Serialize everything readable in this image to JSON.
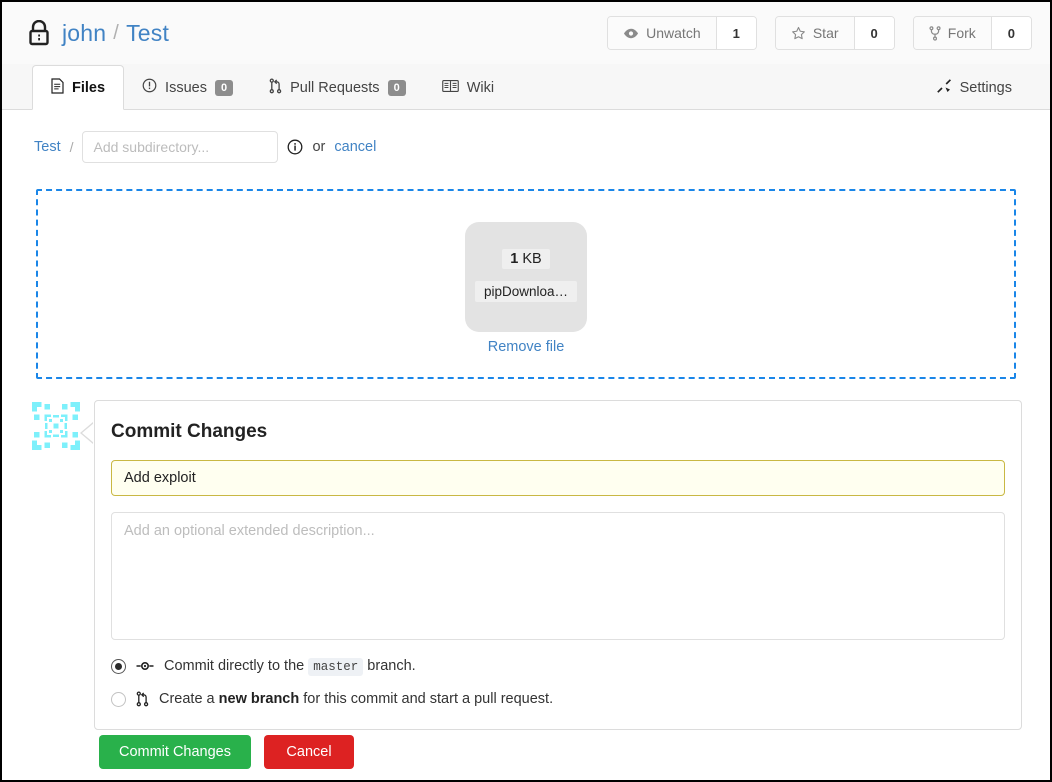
{
  "header": {
    "lock_icon": "lock-icon",
    "owner": "john",
    "separator": "/",
    "repo": "Test",
    "actions": [
      {
        "icon": "eye-icon",
        "label": "Unwatch",
        "count": "1"
      },
      {
        "icon": "star-icon",
        "label": "Star",
        "count": "0"
      },
      {
        "icon": "fork-icon",
        "label": "Fork",
        "count": "0"
      }
    ]
  },
  "tabs": {
    "items": [
      {
        "icon": "file-icon",
        "label": "Files",
        "count": null,
        "active": true
      },
      {
        "icon": "issue-opened-icon",
        "label": "Issues",
        "count": "0",
        "active": false
      },
      {
        "icon": "git-pull-request-icon",
        "label": "Pull Requests",
        "count": "0",
        "active": false
      },
      {
        "icon": "book-icon",
        "label": "Wiki",
        "count": null,
        "active": false
      }
    ],
    "settings": {
      "icon": "tools-icon",
      "label": "Settings"
    }
  },
  "path_row": {
    "crumb": "Test",
    "crumb_separator": "/",
    "subdirectory_placeholder": "Add subdirectory...",
    "subdirectory_value": "",
    "info_icon": "info-icon",
    "or_text": "or",
    "cancel_label": "cancel"
  },
  "dropzone": {
    "border_color": "#1a86e8",
    "file": {
      "size_value": "1",
      "size_unit": "KB",
      "name": "pipDownloa…",
      "highlight_color": "#e11919",
      "remove_label": "Remove file"
    }
  },
  "commit": {
    "avatar_icon": "identicon-avatar",
    "avatar_color": "#7df0fb",
    "title": "Commit Changes",
    "message_value": "Add exploit",
    "message_placeholder": "",
    "description_value": "",
    "description_placeholder": "Add an optional extended description...",
    "options": [
      {
        "icon": "git-commit-icon",
        "selected": true,
        "text_before": "Commit directly to the",
        "code": "master",
        "text_after": "branch."
      },
      {
        "icon": "git-pull-request-icon",
        "selected": false,
        "text_before": "Create a",
        "bold": "new branch",
        "text_after": "for this commit and start a pull request."
      }
    ],
    "buttons": {
      "submit_label": "Commit Changes",
      "submit_color": "#29b14b",
      "cancel_label": "Cancel",
      "cancel_color": "#dd2222"
    }
  }
}
